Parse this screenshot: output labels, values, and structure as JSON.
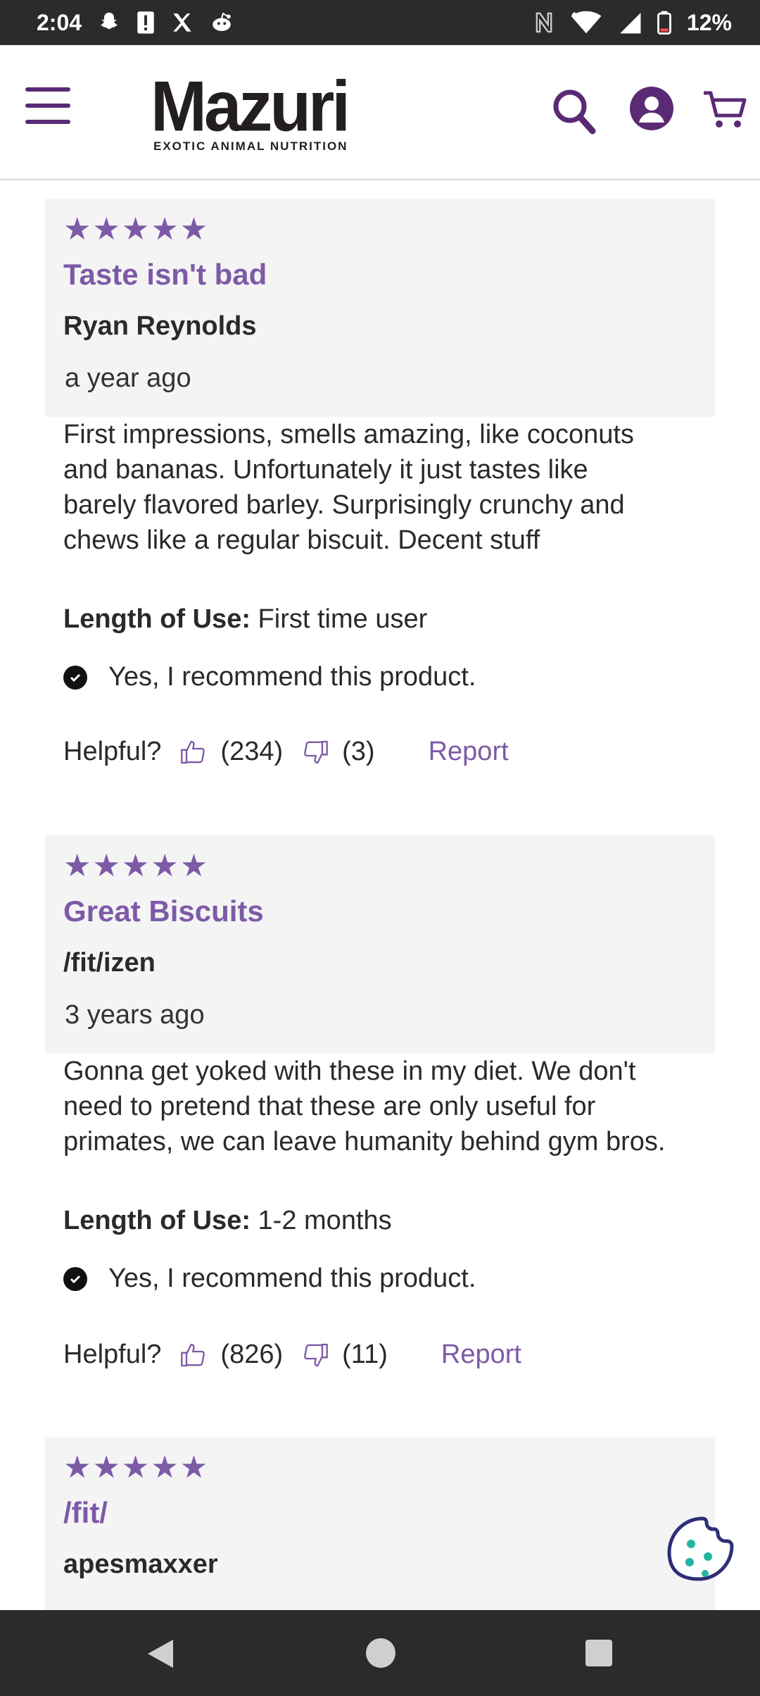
{
  "status": {
    "time": "2:04",
    "battery": "12%"
  },
  "header": {
    "logo_name": "Mazuri",
    "logo_tagline": "EXOTIC ANIMAL NUTRITION",
    "icons": [
      "menu-icon",
      "search-icon",
      "account-icon",
      "cart-icon"
    ]
  },
  "reviews": [
    {
      "stars": "★★★★★",
      "title": "Taste isn't bad",
      "author": "Ryan Reynolds",
      "date": "a year ago",
      "body_lines": [
        "First impressions, smells amazing, like coconuts",
        "and bananas. Unfortunately it just tastes like",
        "barely flavored barley. Surprisingly crunchy and",
        "chews like a regular biscuit. Decent stuff"
      ],
      "length_label": "Length of Use:",
      "length_value": "First time user",
      "recommend": "Yes, I recommend this product.",
      "helpful_label": "Helpful?",
      "up_count": "(234)",
      "down_count": "(3)",
      "report": "Report"
    },
    {
      "stars": "★★★★★",
      "title": "Great Biscuits",
      "author": "/fit/izen",
      "date": "3 years ago",
      "body_lines": [
        "Gonna get yoked with these in my diet. We don't",
        "need to pretend that these are only useful for",
        "primates, we can leave humanity behind gym bros."
      ],
      "length_label": "Length of Use:",
      "length_value": "1-2 months",
      "recommend": "Yes, I recommend this product.",
      "helpful_label": "Helpful?",
      "up_count": "(826)",
      "down_count": "(11)",
      "report": "Report"
    },
    {
      "stars": "★★★★★",
      "title": "/fit/",
      "author": "apesmaxxer"
    }
  ],
  "colors": {
    "accent": "#7d5aa6",
    "brand_dark": "#5b2a74",
    "card_bg": "#f4f4f5",
    "bar": "#2b2b2e"
  }
}
